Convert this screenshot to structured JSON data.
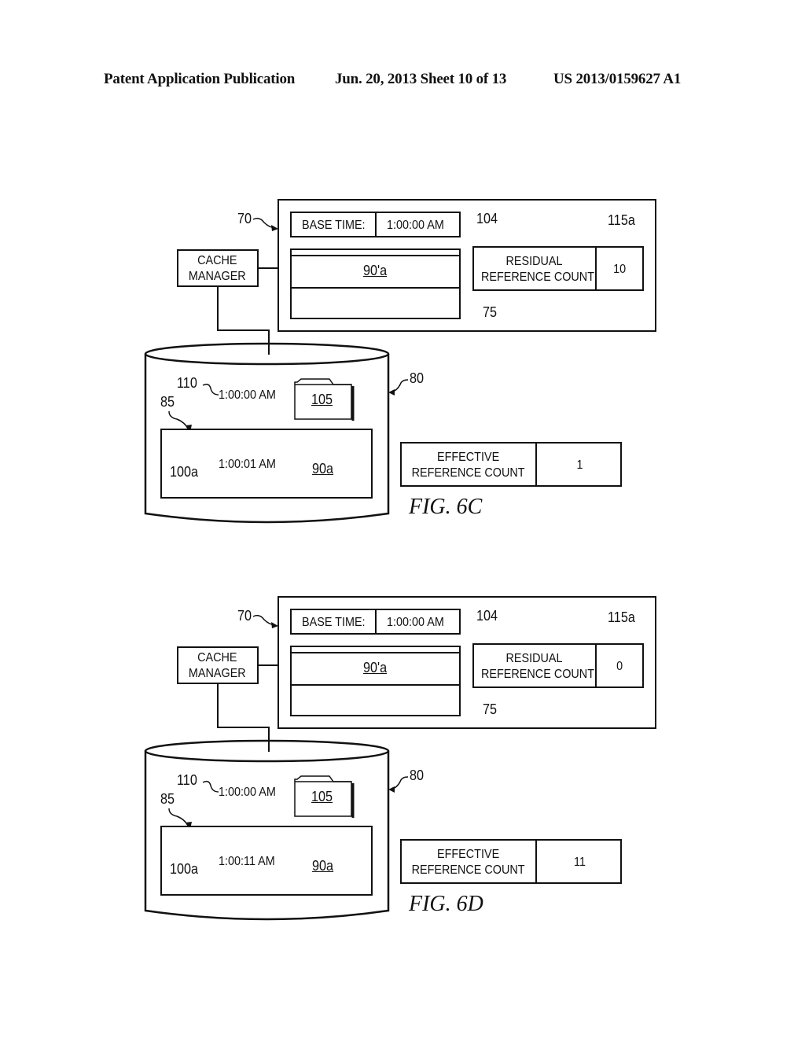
{
  "header": {
    "left": "Patent Application Publication",
    "middle": "Jun. 20, 2013  Sheet 10 of 13",
    "right": "US 2013/0159627 A1"
  },
  "figures": [
    {
      "caption": "FIG. 6C",
      "ref_70": "70",
      "ref_104": "104",
      "ref_115a": "115a",
      "ref_75": "75",
      "ref_80": "80",
      "ref_110": "110",
      "ref_85": "85",
      "ref_100a": "100a",
      "cache_manager": [
        "CACHE",
        "MANAGER"
      ],
      "base_time_label": "BASE TIME:",
      "base_time_value": "1:00:00 AM",
      "cache_entry": "90'a",
      "residual_label": [
        "RESIDUAL",
        "REFERENCE COUNT"
      ],
      "residual_value": "10",
      "storage_time": "1:00:00 AM",
      "storage_folder": "105",
      "snapshot_time": "1:00:01 AM",
      "snapshot_folder": "90a",
      "effective_label": [
        "EFFECTIVE",
        "REFERENCE COUNT"
      ],
      "effective_value": "1"
    },
    {
      "caption": "FIG. 6D",
      "ref_70": "70",
      "ref_104": "104",
      "ref_115a": "115a",
      "ref_75": "75",
      "ref_80": "80",
      "ref_110": "110",
      "ref_85": "85",
      "ref_100a": "100a",
      "cache_manager": [
        "CACHE",
        "MANAGER"
      ],
      "base_time_label": "BASE TIME:",
      "base_time_value": "1:00:00 AM",
      "cache_entry": "90'a",
      "residual_label": [
        "RESIDUAL",
        "REFERENCE COUNT"
      ],
      "residual_value": "0",
      "storage_time": "1:00:00 AM",
      "storage_folder": "105",
      "snapshot_time": "1:00:11 AM",
      "snapshot_folder": "90a",
      "effective_label": [
        "EFFECTIVE",
        "REFERENCE COUNT"
      ],
      "effective_value": "11"
    }
  ]
}
